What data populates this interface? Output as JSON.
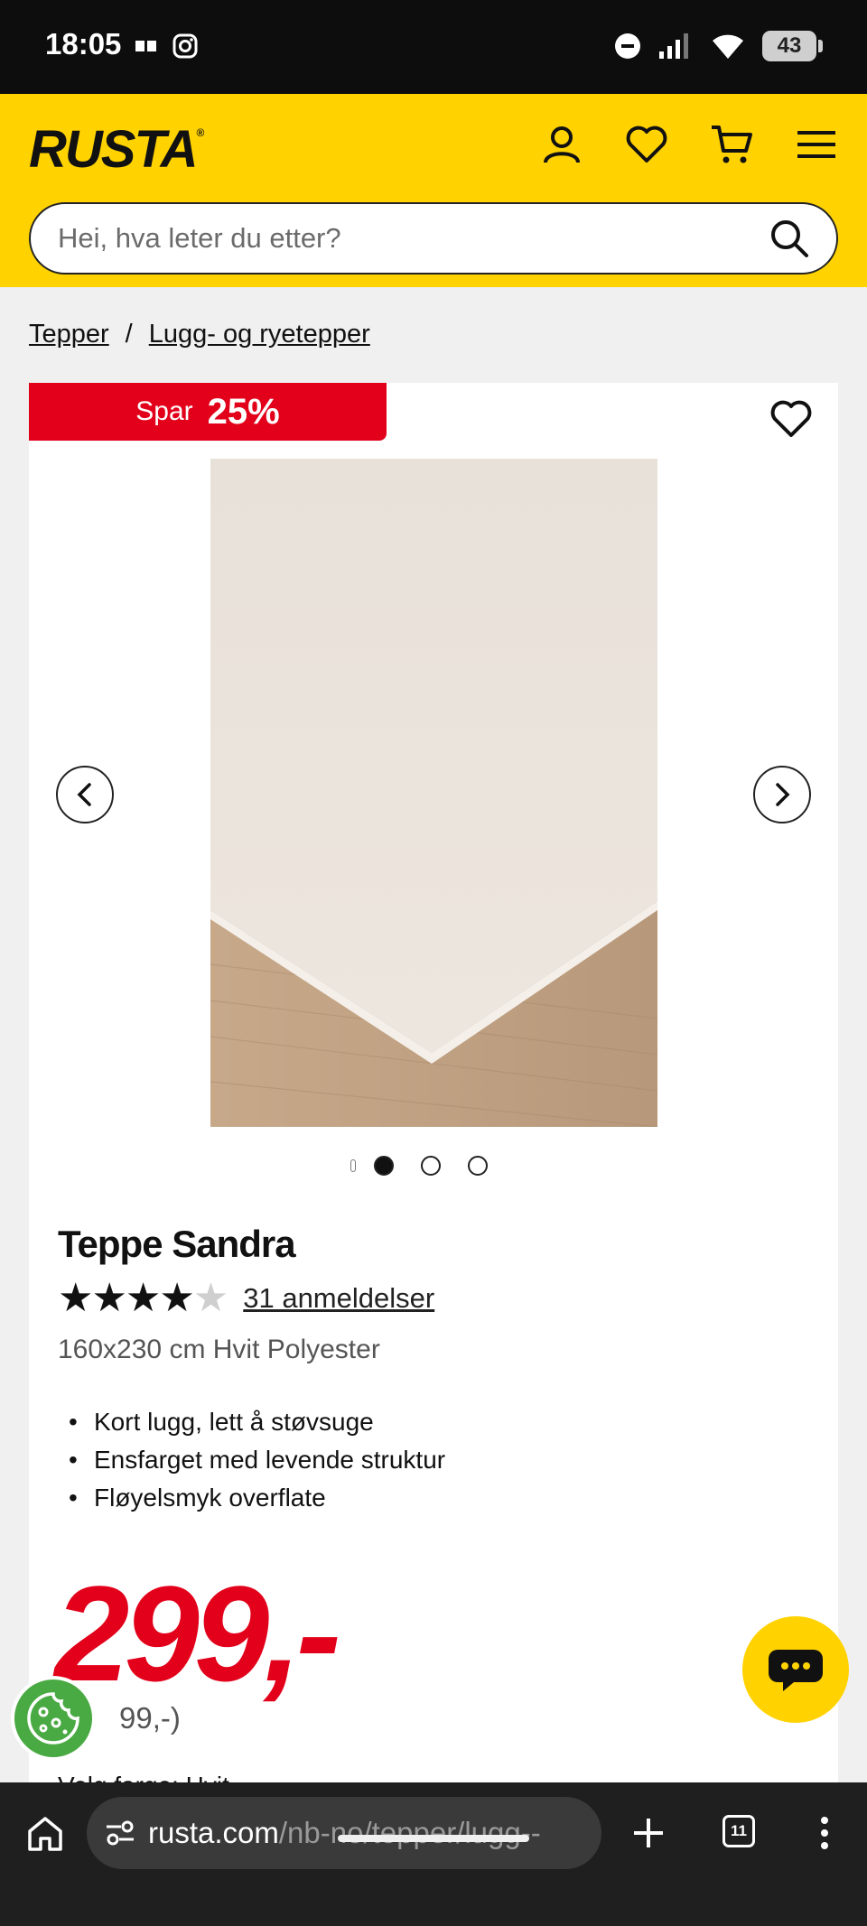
{
  "status_bar": {
    "time": "18:05",
    "battery": "43"
  },
  "header": {
    "logo": "RUSTA",
    "logo_mark": "®",
    "icons": [
      "account-icon",
      "heart-icon",
      "cart-icon",
      "menu-icon"
    ]
  },
  "search": {
    "placeholder": "Hei, hva leter du etter?"
  },
  "breadcrumb": {
    "items": [
      "Tepper",
      "Lugg- og ryetepper"
    ],
    "separator": "/"
  },
  "product": {
    "sale_label": "Spar",
    "sale_value": "25%",
    "title": "Teppe Sandra",
    "rating": 4,
    "rating_max": 5,
    "reviews": "31 anmeldelser",
    "subtitle": "160x230 cm Hvit Polyester",
    "features": [
      "Kort lugg, lett å støvsuge",
      "Ensfarget med levende struktur",
      "Fløyelsmyk overflate"
    ],
    "price": "299,-",
    "old_price": "99,-)",
    "variant_peek": "Velg farge: Hvit",
    "carousel_dots": 4,
    "carousel_active": 1
  },
  "browser": {
    "url_host": "rusta.com",
    "url_path": "/nb-no/tepper/lugg--",
    "tab_count": "11"
  },
  "colors": {
    "brand_yellow": "#ffd200",
    "sale_red": "#e2001a",
    "cookie_green": "#49a942"
  }
}
